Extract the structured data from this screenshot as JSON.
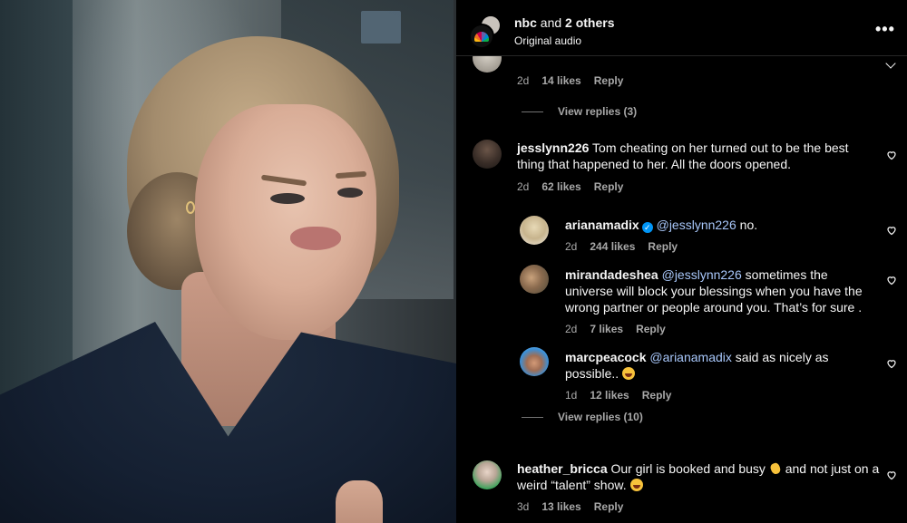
{
  "header": {
    "owner": "nbc",
    "owner_suffix": " and ",
    "collaborators": "2 others",
    "audio": "Original audio",
    "more_glyph": "•••"
  },
  "comments": [
    {
      "id": "c0",
      "meta": {
        "time": "2d",
        "likes": "14 likes",
        "reply": "Reply"
      },
      "view_replies": "View replies (3)"
    },
    {
      "id": "c1",
      "username": "jesslynn226",
      "text": "Tom cheating on her turned out to be the best thing that happened to her. All the doors opened.",
      "meta": {
        "time": "2d",
        "likes": "62 likes",
        "reply": "Reply"
      }
    },
    {
      "id": "r1",
      "username": "arianamadix",
      "verified": true,
      "mention": "@jesslynn226",
      "text": " no.",
      "meta": {
        "time": "2d",
        "likes": "244 likes",
        "reply": "Reply"
      }
    },
    {
      "id": "r2",
      "username": "mirandadeshea",
      "mention": "@jesslynn226",
      "text_line1": " sometimes the universe",
      "text_rest": "will block your blessings when you have the wrong partner or people around you. That’s for sure .",
      "meta": {
        "time": "2d",
        "likes": "7 likes",
        "reply": "Reply"
      }
    },
    {
      "id": "r3",
      "username": "marcpeacock",
      "mention": "@arianamadix",
      "text_line1": " said as nicely as",
      "text_rest": "possible.. ",
      "emoji": "laughing-face",
      "meta": {
        "time": "1d",
        "likes": "12 likes",
        "reply": "Reply"
      },
      "view_replies": "View replies (10)"
    },
    {
      "id": "c2",
      "username": "heather_bricca",
      "text_line1": "Our girl is booked and busy ",
      "text_line1_after": " and not just on",
      "text_rest": "a weird “talent” show. ",
      "meta": {
        "time": "3d",
        "likes": "13 likes",
        "reply": "Reply"
      }
    }
  ],
  "colors": {
    "accent": "#0095f6",
    "mention": "#a8c7fa",
    "muted": "#a8a8a8",
    "background": "#000000"
  }
}
